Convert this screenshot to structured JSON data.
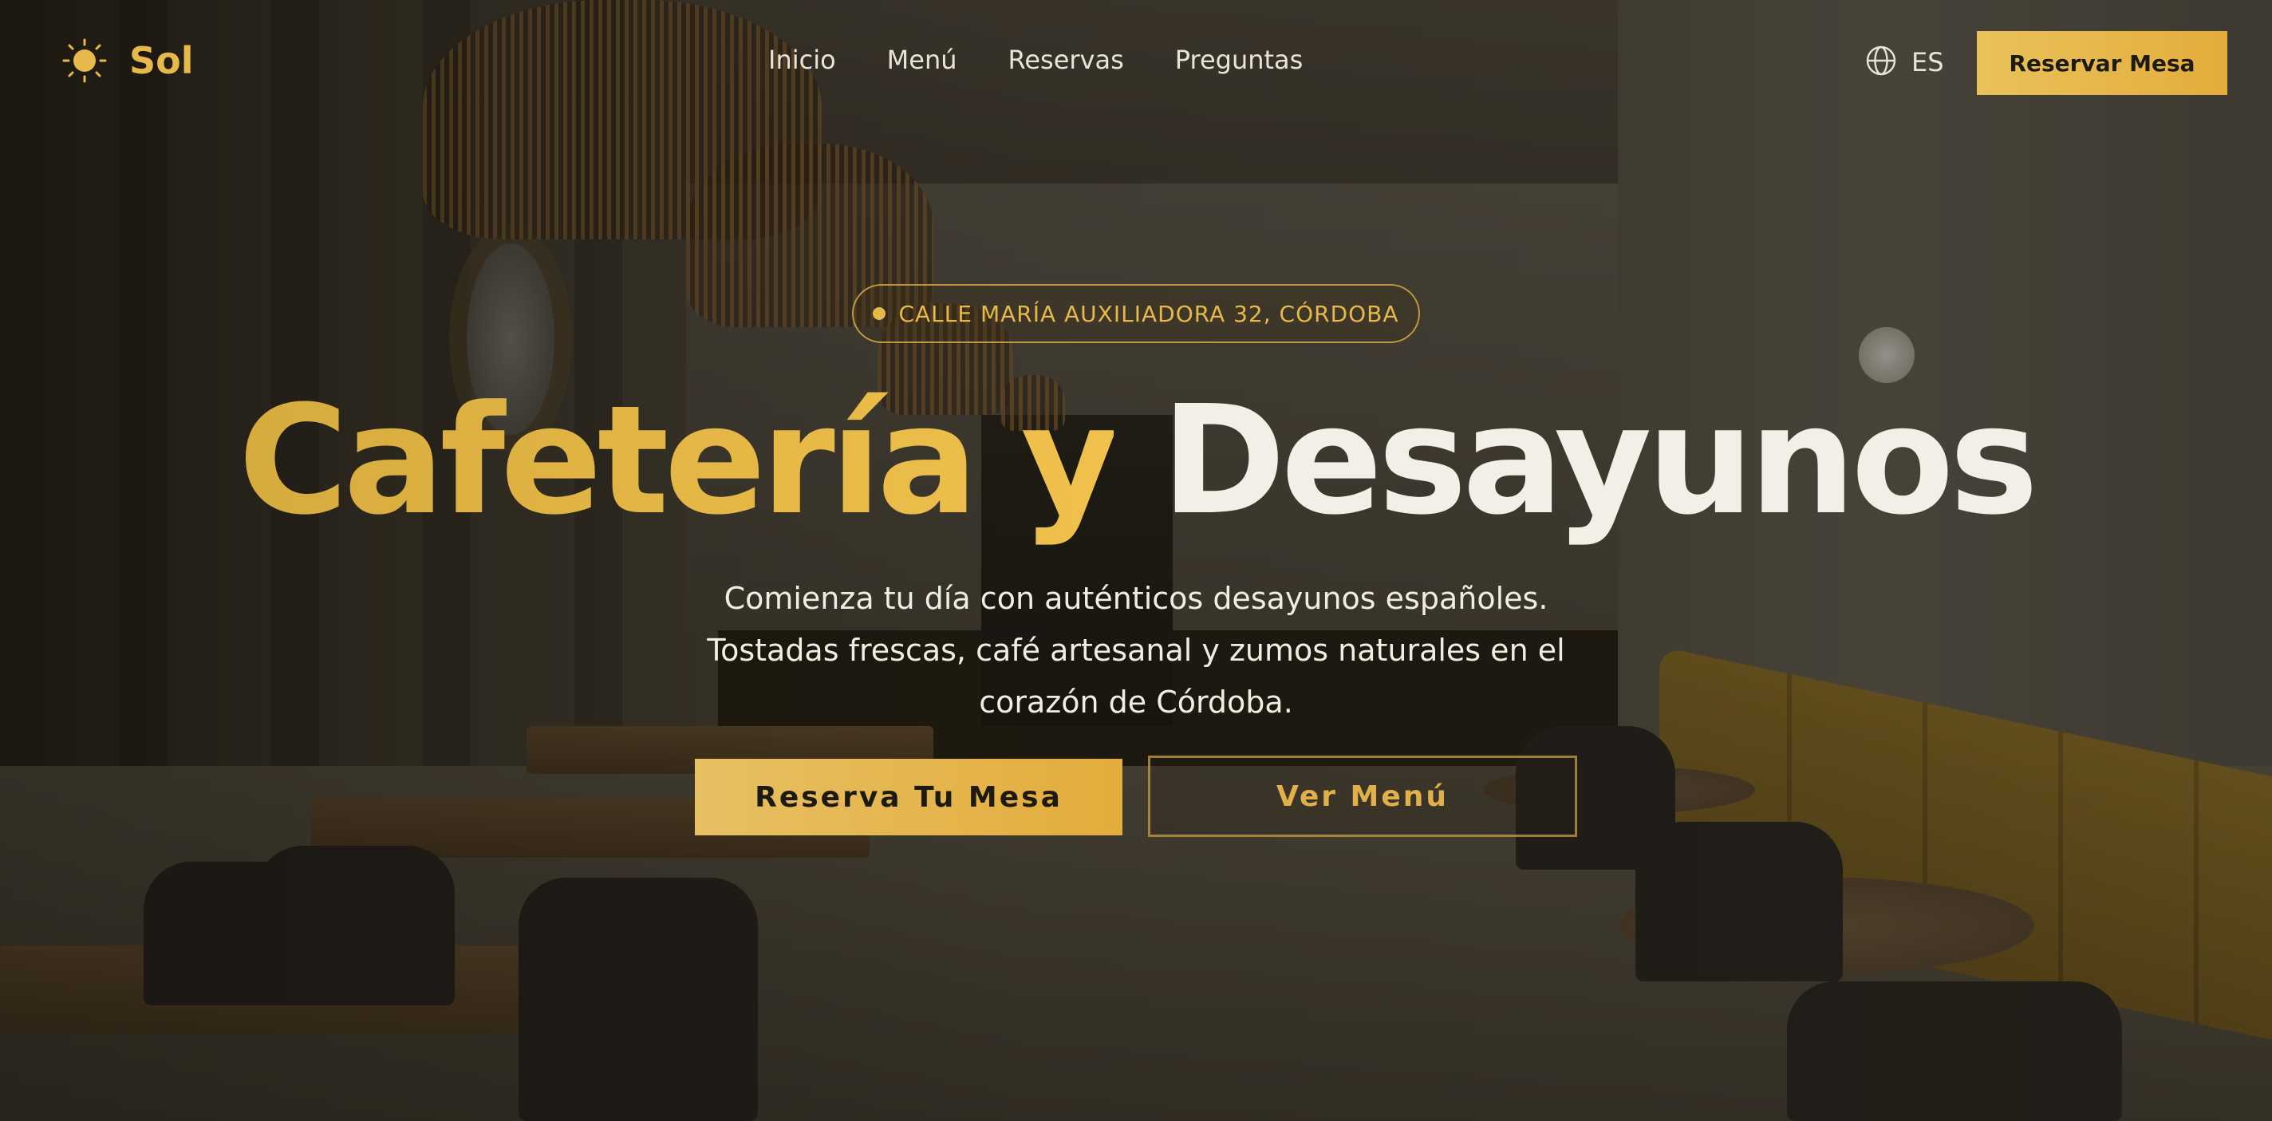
{
  "brand": {
    "name": "Sol",
    "icon": "sun-icon",
    "color": "#e7b94a"
  },
  "nav": {
    "links": [
      "Inicio",
      "Menú",
      "Reservas",
      "Preguntas"
    ],
    "language": {
      "icon": "globe-icon",
      "label": "ES"
    },
    "cta_label": "Reservar Mesa"
  },
  "hero": {
    "badge": "CALLE MARÍA AUXILIADORA 32, CÓRDOBA",
    "title_gold": "Cafetería y",
    "title_white": "Desayunos",
    "subtitle": "Comienza tu día con auténticos desayunos españoles. Tostadas frescas, café artesanal y zumos naturales en el corazón de Córdoba.",
    "primary_button": "Reserva Tu Mesa",
    "secondary_button": "Ver Menú"
  },
  "colors": {
    "accent": "#e7b94a",
    "accent_dark": "#e4ac3c",
    "text_light": "#f2efe7"
  }
}
